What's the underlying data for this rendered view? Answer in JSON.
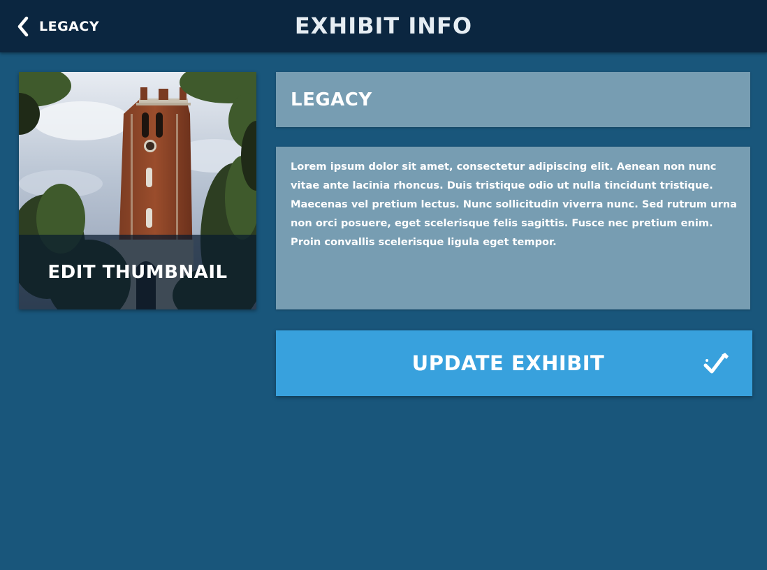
{
  "header": {
    "back_label": "LEGACY",
    "title": "EXHIBIT INFO",
    "back_icon": "chevron-left-icon"
  },
  "thumbnail": {
    "label": "EDIT THUMBNAIL",
    "image_subject": "brick bell tower among trees under cloudy sky"
  },
  "form": {
    "name_value": "LEGACY",
    "description_value": "Lorem ipsum dolor sit amet, consectetur adipiscing elit. Aenean non nunc vitae ante lacinia rhoncus. Duis tristique odio ut nulla tincidunt tristique. Maecenas vel pretium lectus. Nunc sollicitudin viverra nunc. Sed rutrum urna non orci posuere, eget scelerisque felis sagittis. Fusce nec pretium enim. Proin convallis scelerisque ligula eget tempor."
  },
  "actions": {
    "update_label": "UPDATE EXHIBIT",
    "update_icon": "check-pencil-icon"
  },
  "colors": {
    "background": "#19567b",
    "topbar": "#0b2640",
    "field": "#779db2",
    "accent_button": "#38a1dd",
    "text": "#ffffff"
  }
}
